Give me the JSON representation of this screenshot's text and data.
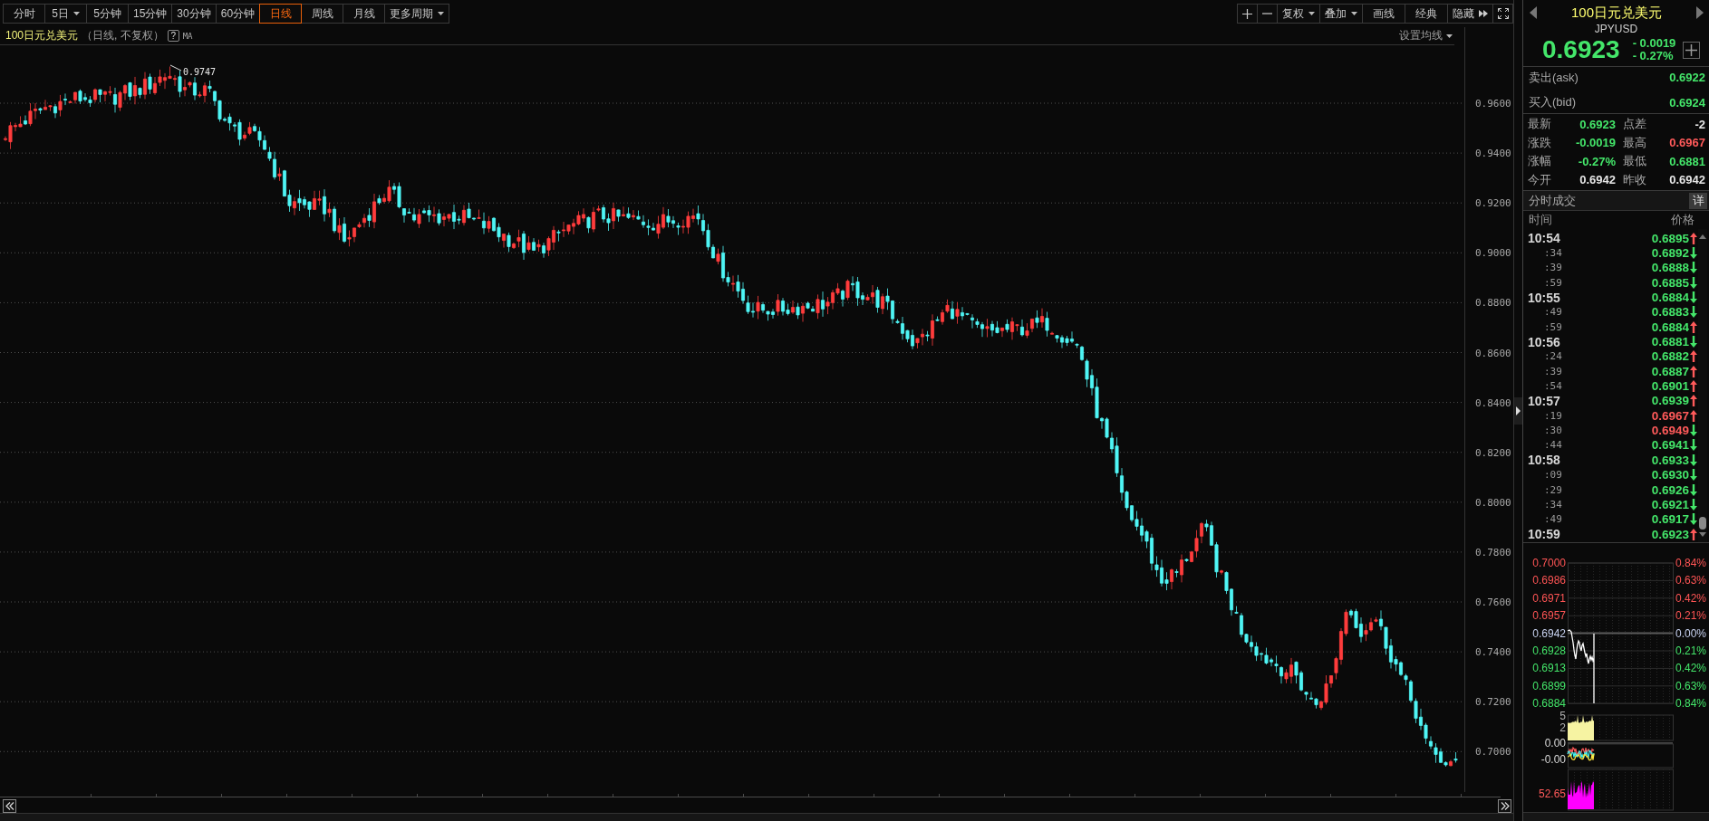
{
  "toolbar": {
    "periods": [
      {
        "label": "分时",
        "selected": false,
        "dropdown": false
      },
      {
        "label": "5日",
        "selected": false,
        "dropdown": true
      },
      {
        "label": "5分钟",
        "selected": false,
        "dropdown": false
      },
      {
        "label": "15分钟",
        "selected": false,
        "dropdown": false
      },
      {
        "label": "30分钟",
        "selected": false,
        "dropdown": false
      },
      {
        "label": "60分钟",
        "selected": false,
        "dropdown": false
      },
      {
        "label": "日线",
        "selected": true,
        "dropdown": false
      },
      {
        "label": "周线",
        "selected": false,
        "dropdown": false
      },
      {
        "label": "月线",
        "selected": false,
        "dropdown": false
      },
      {
        "label": "更多周期",
        "selected": false,
        "dropdown": true
      }
    ],
    "tools": [
      {
        "kind": "plus"
      },
      {
        "kind": "minus"
      },
      {
        "kind": "menu",
        "label": "复权"
      },
      {
        "kind": "menu",
        "label": "叠加"
      },
      {
        "kind": "button",
        "label": "画线"
      },
      {
        "kind": "button",
        "label": "经典"
      },
      {
        "kind": "collapse",
        "label": "隐藏"
      },
      {
        "kind": "fullscreen"
      }
    ]
  },
  "chart_header": {
    "title": "100日元兑美元",
    "subtitle": "（日线, 不复权）",
    "help": "?",
    "indicator": "MA",
    "ma_button": "设置均线"
  },
  "kline": {
    "y_ticks": [
      "0.9600",
      "0.9400",
      "0.9200",
      "0.9000",
      "0.8800",
      "0.8600",
      "0.8400",
      "0.8200",
      "0.8000",
      "0.7800",
      "0.7600",
      "0.7400",
      "0.7200",
      "0.7000"
    ],
    "max_label": "0.9747"
  },
  "quote": {
    "name": "100日元兑美元",
    "code": "JPYUSD",
    "price": "0.6923",
    "change": "- 0.0019",
    "change_pct": "- 0.27%"
  },
  "ask_bid": [
    {
      "label": "卖出(ask)",
      "value": "0.6922"
    },
    {
      "label": "买入(bid)",
      "value": "0.6924"
    }
  ],
  "stats": [
    {
      "label": "最新",
      "value": "0.6923",
      "color": "#44e66a"
    },
    {
      "label": "点差",
      "value": "-2",
      "color": "#e6e6e6"
    },
    {
      "label": "涨跌",
      "value": "-0.0019",
      "color": "#44e66a"
    },
    {
      "label": "最高",
      "value": "0.6967",
      "color": "#ff5a5a"
    },
    {
      "label": "涨幅",
      "value": "-0.27%",
      "color": "#44e66a"
    },
    {
      "label": "最低",
      "value": "0.6881",
      "color": "#44e66a"
    },
    {
      "label": "今开",
      "value": "0.6942",
      "color": "#e6e6e6"
    },
    {
      "label": "昨收",
      "value": "0.6942",
      "color": "#e6e6e6"
    }
  ],
  "trades": {
    "title": "分时成交",
    "detail": "详",
    "columns": [
      "时间",
      "价格"
    ],
    "rows": [
      {
        "time": "10:54",
        "kind": "minute",
        "price": "0.6895",
        "color": "#44e66a",
        "uptick": true
      },
      {
        "time": ":34",
        "kind": "second",
        "price": "0.6892",
        "color": "#44e66a",
        "uptick": false
      },
      {
        "time": ":39",
        "kind": "second",
        "price": "0.6888",
        "color": "#44e66a",
        "uptick": false
      },
      {
        "time": ":59",
        "kind": "second",
        "price": "0.6885",
        "color": "#44e66a",
        "uptick": false
      },
      {
        "time": "10:55",
        "kind": "minute",
        "price": "0.6884",
        "color": "#44e66a",
        "uptick": false
      },
      {
        "time": ":49",
        "kind": "second",
        "price": "0.6883",
        "color": "#44e66a",
        "uptick": false
      },
      {
        "time": ":59",
        "kind": "second",
        "price": "0.6884",
        "color": "#44e66a",
        "uptick": true
      },
      {
        "time": "10:56",
        "kind": "minute",
        "price": "0.6881",
        "color": "#44e66a",
        "uptick": false
      },
      {
        "time": ":24",
        "kind": "second",
        "price": "0.6882",
        "color": "#44e66a",
        "uptick": true
      },
      {
        "time": ":39",
        "kind": "second",
        "price": "0.6887",
        "color": "#44e66a",
        "uptick": true
      },
      {
        "time": ":54",
        "kind": "second",
        "price": "0.6901",
        "color": "#44e66a",
        "uptick": true
      },
      {
        "time": "10:57",
        "kind": "minute",
        "price": "0.6939",
        "color": "#44e66a",
        "uptick": true
      },
      {
        "time": ":19",
        "kind": "second",
        "price": "0.6967",
        "color": "#ff5a5a",
        "uptick": true
      },
      {
        "time": ":30",
        "kind": "second",
        "price": "0.6949",
        "color": "#ff5a5a",
        "uptick": false
      },
      {
        "time": ":44",
        "kind": "second",
        "price": "0.6941",
        "color": "#44e66a",
        "uptick": false
      },
      {
        "time": "10:58",
        "kind": "minute",
        "price": "0.6933",
        "color": "#44e66a",
        "uptick": false
      },
      {
        "time": ":09",
        "kind": "second",
        "price": "0.6930",
        "color": "#44e66a",
        "uptick": false
      },
      {
        "time": ":29",
        "kind": "second",
        "price": "0.6926",
        "color": "#44e66a",
        "uptick": false
      },
      {
        "time": ":34",
        "kind": "second",
        "price": "0.6921",
        "color": "#44e66a",
        "uptick": false
      },
      {
        "time": ":49",
        "kind": "second",
        "price": "0.6917",
        "color": "#44e66a",
        "uptick": false
      },
      {
        "time": "10:59",
        "kind": "minute",
        "price": "0.6923",
        "color": "#44e66a",
        "uptick": true
      }
    ]
  },
  "intraday": {
    "levels": [
      {
        "price": "0.7000",
        "percent": "0.84%",
        "color": "#ff5555"
      },
      {
        "price": "0.6986",
        "percent": "0.63%",
        "color": "#ff5555"
      },
      {
        "price": "0.6971",
        "percent": "0.42%",
        "color": "#ff5555"
      },
      {
        "price": "0.6957",
        "percent": "0.21%",
        "color": "#ff5555"
      },
      {
        "price": "0.6942",
        "percent": "0.00%",
        "color": "#c8d2f0"
      },
      {
        "price": "0.6928",
        "percent": "0.21%",
        "color": "#44e66a"
      },
      {
        "price": "0.6913",
        "percent": "0.42%",
        "color": "#44e66a"
      },
      {
        "price": "0.6899",
        "percent": "0.63%",
        "color": "#44e66a"
      },
      {
        "price": "0.6884",
        "percent": "0.84%",
        "color": "#44e66a"
      }
    ],
    "volume_labels": [
      "5",
      "2"
    ],
    "indicator_labels": [
      "0.00",
      "-0.00"
    ],
    "oscillator_labels": [
      "52.65"
    ]
  }
}
